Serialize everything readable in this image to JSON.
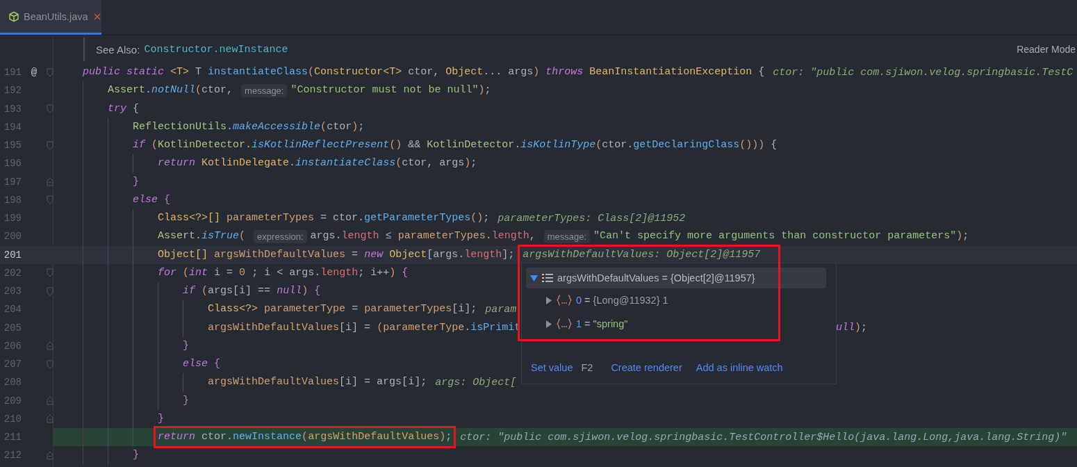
{
  "tabs": [
    {
      "label": "BeanUtils.java",
      "selected": true
    }
  ],
  "doc": {
    "label": "See Also:",
    "link": "Constructor.newInstance",
    "mode_button": "Reader Mode"
  },
  "lines": [
    {
      "number": "191",
      "gutter_mark": "@",
      "fold_start": true,
      "tokens": [
        {
          "kind": "kw",
          "text": "public "
        },
        {
          "kind": "kw",
          "text": "static "
        },
        {
          "kind": "type",
          "text": "<T>"
        },
        {
          "kind": "p",
          "text": " T "
        },
        {
          "kind": "fn",
          "text": "instantiateClass"
        },
        {
          "kind": "brk",
          "text": "("
        },
        {
          "kind": "type",
          "text": "Constructor<T>"
        },
        {
          "kind": "p",
          "text": " ctor, "
        },
        {
          "kind": "type",
          "text": "Object"
        },
        {
          "kind": "p",
          "text": "... args"
        },
        {
          "kind": "brk",
          "text": ")"
        },
        {
          "kind": "kw",
          "text": " throws "
        },
        {
          "kind": "type",
          "text": "BeanInstantiationException"
        },
        {
          "kind": "p",
          "text": " {"
        },
        {
          "kind": "hint",
          "text": "ctor: \"public com.sjiwon.velog.springbasic.TestC"
        }
      ]
    },
    {
      "number": "192",
      "tokens": [
        {
          "kind": "cls",
          "text": "    Assert"
        },
        {
          "kind": "p",
          "text": "."
        },
        {
          "kind": "sfn",
          "text": "notNull"
        },
        {
          "kind": "brk",
          "text": "("
        },
        {
          "kind": "p",
          "text": "ctor,"
        },
        {
          "kind": "label",
          "text": "message:"
        },
        {
          "kind": "str",
          "text": "\"Constructor must not be null\""
        },
        {
          "kind": "brk",
          "text": ")"
        },
        {
          "kind": "p",
          "text": ";"
        }
      ]
    },
    {
      "number": "193",
      "fold_start": true,
      "tokens": [
        {
          "kind": "kw",
          "text": "    try"
        },
        {
          "kind": "p",
          "text": " {"
        }
      ]
    },
    {
      "number": "194",
      "tokens": [
        {
          "kind": "cls",
          "text": "        ReflectionUtils"
        },
        {
          "kind": "p",
          "text": "."
        },
        {
          "kind": "sfn",
          "text": "makeAccessible"
        },
        {
          "kind": "brk",
          "text": "("
        },
        {
          "kind": "p",
          "text": "ctor"
        },
        {
          "kind": "brk",
          "text": ")"
        },
        {
          "kind": "p",
          "text": ";"
        }
      ]
    },
    {
      "number": "195",
      "fold_start": true,
      "tokens": [
        {
          "kind": "kw",
          "text": "        if "
        },
        {
          "kind": "brk",
          "text": "("
        },
        {
          "kind": "cls",
          "text": "KotlinDetector"
        },
        {
          "kind": "p",
          "text": "."
        },
        {
          "kind": "sfn",
          "text": "isKotlinReflectPresent"
        },
        {
          "kind": "brk",
          "text": "()"
        },
        {
          "kind": "p",
          "text": " && "
        },
        {
          "kind": "cls",
          "text": "KotlinDetector"
        },
        {
          "kind": "p",
          "text": "."
        },
        {
          "kind": "sfn",
          "text": "isKotlinType"
        },
        {
          "kind": "brk",
          "text": "("
        },
        {
          "kind": "p",
          "text": "ctor."
        },
        {
          "kind": "fn",
          "text": "getDeclaringClass"
        },
        {
          "kind": "brk",
          "text": "()))"
        },
        {
          "kind": "p",
          "text": " {"
        }
      ]
    },
    {
      "number": "196",
      "tokens": [
        {
          "kind": "kw",
          "text": "            return "
        },
        {
          "kind": "type",
          "text": "KotlinDelegate"
        },
        {
          "kind": "p",
          "text": "."
        },
        {
          "kind": "sfn",
          "text": "instantiateClass"
        },
        {
          "kind": "brk",
          "text": "("
        },
        {
          "kind": "p",
          "text": "ctor, args"
        },
        {
          "kind": "brk",
          "text": ")"
        },
        {
          "kind": "p",
          "text": ";"
        }
      ]
    },
    {
      "number": "197",
      "fold_end": true,
      "tokens": [
        {
          "kind": "brace",
          "text": "        }"
        }
      ]
    },
    {
      "number": "198",
      "fold_start": true,
      "tokens": [
        {
          "kind": "kw",
          "text": "        else "
        },
        {
          "kind": "brace",
          "text": "{"
        }
      ]
    },
    {
      "number": "199",
      "tokens": [
        {
          "kind": "type",
          "text": "            Class<?>[]"
        },
        {
          "kind": "var",
          "text": " parameterTypes"
        },
        {
          "kind": "p",
          "text": " = ctor."
        },
        {
          "kind": "fn",
          "text": "getParameterTypes"
        },
        {
          "kind": "brk",
          "text": "()"
        },
        {
          "kind": "p",
          "text": ";"
        },
        {
          "kind": "hint",
          "text": "parameterTypes: Class[2]@11952"
        }
      ]
    },
    {
      "number": "200",
      "tokens": [
        {
          "kind": "cls",
          "text": "            Assert"
        },
        {
          "kind": "p",
          "text": "."
        },
        {
          "kind": "sfn",
          "text": "isTrue"
        },
        {
          "kind": "brk",
          "text": "("
        },
        {
          "kind": "label",
          "text": "expression:"
        },
        {
          "kind": "p",
          "text": "args."
        },
        {
          "kind": "field",
          "text": "length"
        },
        {
          "kind": "p",
          "text": " ≤ "
        },
        {
          "kind": "var",
          "text": "parameterTypes"
        },
        {
          "kind": "p",
          "text": "."
        },
        {
          "kind": "field",
          "text": "length"
        },
        {
          "kind": "p",
          "text": ","
        },
        {
          "kind": "label",
          "text": "message:"
        },
        {
          "kind": "str",
          "text": "\"Can't specify more arguments than constructor parameters\""
        },
        {
          "kind": "brk",
          "text": ")"
        },
        {
          "kind": "p",
          "text": ";"
        }
      ]
    },
    {
      "number": "201",
      "current": true,
      "tokens": [
        {
          "kind": "type",
          "text": "            Object[]"
        },
        {
          "kind": "var",
          "text": " argsWithDefaultValues"
        },
        {
          "kind": "p",
          "text": " = "
        },
        {
          "kind": "kw",
          "text": "new "
        },
        {
          "kind": "type",
          "text": "Object"
        },
        {
          "kind": "p",
          "text": "[args."
        },
        {
          "kind": "field",
          "text": "length"
        },
        {
          "kind": "p",
          "text": "];"
        },
        {
          "kind": "hint",
          "text": "argsWithDefaultValues: Object[2]@11957"
        }
      ]
    },
    {
      "number": "202",
      "fold_start": true,
      "tokens": [
        {
          "kind": "kw",
          "text": "            for "
        },
        {
          "kind": "brk",
          "text": "("
        },
        {
          "kind": "kw",
          "text": "int"
        },
        {
          "kind": "p",
          "text": " i = "
        },
        {
          "kind": "num",
          "text": "0"
        },
        {
          "kind": "p",
          "text": " ; i < args."
        },
        {
          "kind": "field",
          "text": "length"
        },
        {
          "kind": "p",
          "text": "; i++"
        },
        {
          "kind": "brk",
          "text": ")"
        },
        {
          "kind": "brace",
          "text": " {"
        }
      ]
    },
    {
      "number": "203",
      "fold_start": true,
      "tokens": [
        {
          "kind": "kw",
          "text": "                if "
        },
        {
          "kind": "brk",
          "text": "("
        },
        {
          "kind": "p",
          "text": "args[i] == "
        },
        {
          "kind": "kw",
          "text": "null"
        },
        {
          "kind": "brk",
          "text": ")"
        },
        {
          "kind": "brace",
          "text": " {"
        }
      ]
    },
    {
      "number": "204",
      "tokens": [
        {
          "kind": "type",
          "text": "                    Class<?>"
        },
        {
          "kind": "var",
          "text": " parameterType"
        },
        {
          "kind": "p",
          "text": " = "
        },
        {
          "kind": "var",
          "text": "parameterTypes"
        },
        {
          "kind": "p",
          "text": "[i];"
        },
        {
          "kind": "hint",
          "text": "param"
        }
      ]
    },
    {
      "number": "205",
      "tokens": [
        {
          "kind": "var",
          "text": "                    argsWithDefaultValues"
        },
        {
          "kind": "p",
          "text": "[i] = "
        },
        {
          "kind": "brk",
          "text": "("
        },
        {
          "kind": "var",
          "text": "parameterType"
        },
        {
          "kind": "p",
          "text": "."
        },
        {
          "kind": "fn",
          "text": "isPrimit"
        }
      ],
      "after_popup": [
        {
          "kind": "kw",
          "text": "ull"
        },
        {
          "kind": "brk",
          "text": ")"
        },
        {
          "kind": "p",
          "text": ";"
        }
      ]
    },
    {
      "number": "206",
      "fold_end": true,
      "tokens": [
        {
          "kind": "brace",
          "text": "                }"
        }
      ]
    },
    {
      "number": "207",
      "fold_start": true,
      "tokens": [
        {
          "kind": "kw",
          "text": "                else "
        },
        {
          "kind": "brace",
          "text": "{"
        }
      ]
    },
    {
      "number": "208",
      "tokens": [
        {
          "kind": "var",
          "text": "                    argsWithDefaultValues"
        },
        {
          "kind": "p",
          "text": "[i] = args[i];"
        },
        {
          "kind": "hint",
          "text": "args: Object["
        }
      ]
    },
    {
      "number": "209",
      "fold_end": true,
      "tokens": [
        {
          "kind": "brace",
          "text": "                }"
        }
      ]
    },
    {
      "number": "210",
      "fold_end": true,
      "tokens": [
        {
          "kind": "brace",
          "text": "            }"
        }
      ]
    },
    {
      "number": "211",
      "execution_point": true,
      "annotated": true,
      "tokens": [
        {
          "kind": "kw",
          "text": "            return"
        },
        {
          "kind": "p",
          "text": " ctor."
        },
        {
          "kind": "fn",
          "text": "newInstance"
        },
        {
          "kind": "brk",
          "text": "("
        },
        {
          "kind": "var",
          "text": "argsWithDefaultValues"
        },
        {
          "kind": "brk",
          "text": ")"
        },
        {
          "kind": "p",
          "text": ";"
        },
        {
          "kind": "hint",
          "text": "ctor: \"public com.sjiwon.velog.springbasic.TestController$Hello(java.lang.Long,java.lang.String)\""
        }
      ]
    },
    {
      "number": "212",
      "fold_end": true,
      "tokens": [
        {
          "kind": "brace",
          "text": "        }"
        }
      ]
    }
  ],
  "popup": {
    "annotated": true,
    "root": {
      "name": "argsWithDefaultValues",
      "separator": "=",
      "value": "{Object[2]@11957}",
      "expanded": true,
      "selected": true,
      "children": [
        {
          "name": "0",
          "separator": "=",
          "value": "{Long@11932} 1",
          "kind": "object",
          "expanded": false
        },
        {
          "name": "1",
          "separator": "=",
          "value": "\"spring\"",
          "kind": "string",
          "expanded": false
        }
      ]
    },
    "actions": [
      {
        "label": "Set value",
        "shortcut": "F2"
      },
      {
        "label": "Create renderer"
      },
      {
        "label": "Add as inline watch"
      }
    ]
  }
}
